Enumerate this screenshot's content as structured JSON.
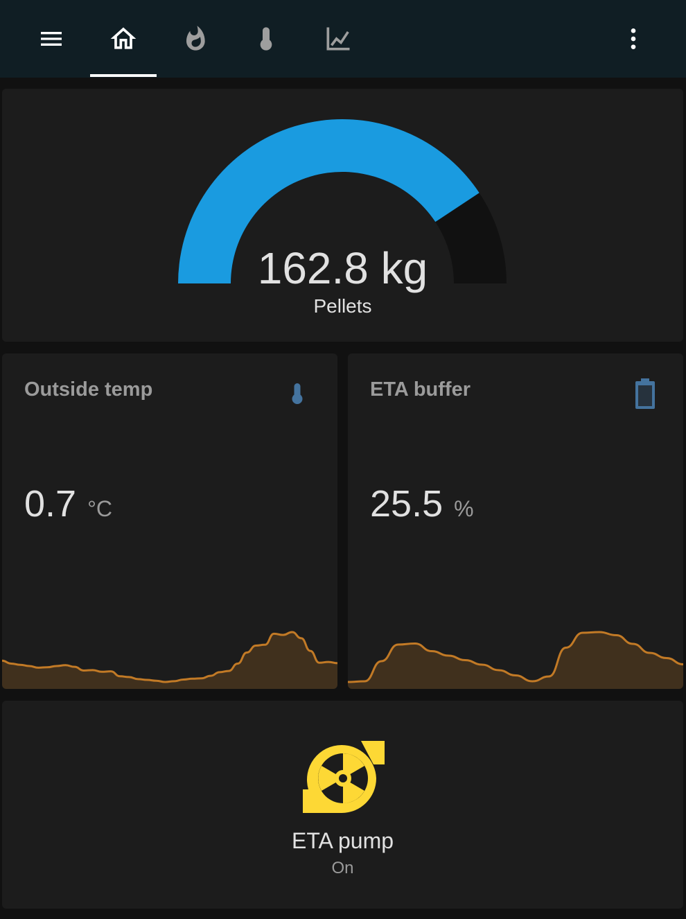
{
  "colors": {
    "header_bg": "#101e24",
    "card_bg": "#1c1c1c",
    "gauge_fill": "#1a9be0",
    "gauge_track": "#111111",
    "sensor_icon": "#44739e",
    "sparkline": "#c27a26",
    "pump_icon": "#fdd835"
  },
  "header": {
    "tabs": [
      {
        "icon": "menu-icon",
        "active": false
      },
      {
        "icon": "home-icon",
        "active": true
      },
      {
        "icon": "fire-icon",
        "active": false
      },
      {
        "icon": "thermometer-icon",
        "active": false
      },
      {
        "icon": "chart-line-icon",
        "active": false
      }
    ],
    "overflow_icon": "dots-vertical-icon"
  },
  "gauge": {
    "value_text": "162.8 kg",
    "label": "Pellets",
    "fill_fraction": 0.814
  },
  "sensors": [
    {
      "name": "Outside temp",
      "value": "0.7",
      "unit": "°C",
      "icon": "thermometer-icon",
      "history": [
        10.9,
        10.2,
        9.9,
        9.6,
        9.2,
        9.3,
        9.6,
        9.8,
        9.4,
        8.5,
        8.6,
        8.2,
        8.3,
        7.1,
        6.9,
        6.4,
        6.2,
        6.0,
        5.7,
        5.9,
        6.3,
        6.5,
        6.6,
        7.2,
        8.1,
        8.4,
        10.2,
        12.9,
        14.6,
        14.8,
        17.5,
        17.2,
        17.9,
        16.4,
        13.3,
        10.4,
        10.6,
        10.3
      ]
    },
    {
      "name": "ETA buffer",
      "value": "25.5",
      "unit": "%",
      "icon": "battery-icon",
      "history": [
        5.2,
        5.4,
        11.2,
        16.0,
        16.3,
        14.1,
        12.8,
        11.5,
        10.2,
        8.6,
        7.1,
        5.4,
        6.8,
        15.1,
        19.4,
        19.6,
        18.7,
        16.2,
        13.6,
        12.1,
        10.3
      ]
    }
  ],
  "pump": {
    "name": "ETA pump",
    "state": "On",
    "icon": "pump-icon"
  }
}
